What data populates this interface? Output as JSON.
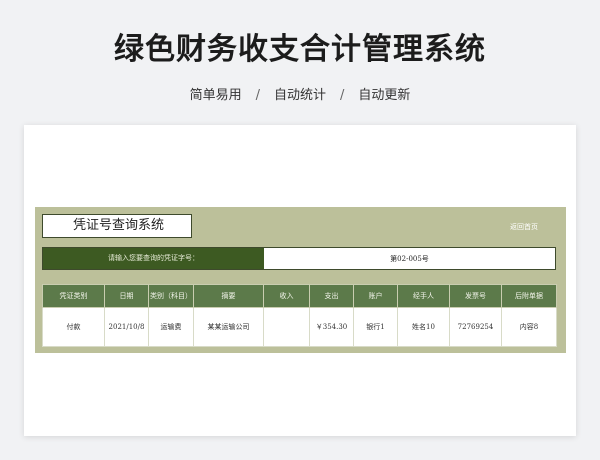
{
  "header": {
    "title": "绿色财务收支合计管理系统",
    "tagline": [
      "简单易用",
      "自动统计",
      "自动更新"
    ],
    "separator": "/"
  },
  "app": {
    "system_title": "凭证号查询系统",
    "back_link": "返回首页",
    "search": {
      "label": "请输入您要查询的凭证字号：",
      "value": "第02-005号"
    }
  },
  "table": {
    "columns": [
      "凭证类别",
      "日期",
      "类别（科目）",
      "摘要",
      "收入",
      "支出",
      "账户",
      "经手人",
      "发票号",
      "后附单据"
    ],
    "rows": [
      [
        "付款",
        "2021/10/8",
        "运输费",
        "某某运输公司",
        "",
        "￥354.30",
        "银行1",
        "姓名10",
        "72769254",
        "内容8"
      ]
    ]
  },
  "colors": {
    "sheet_bg": "#bcc09a",
    "dark_green": "#3d5a22",
    "header_green": "#5c7a4a"
  }
}
